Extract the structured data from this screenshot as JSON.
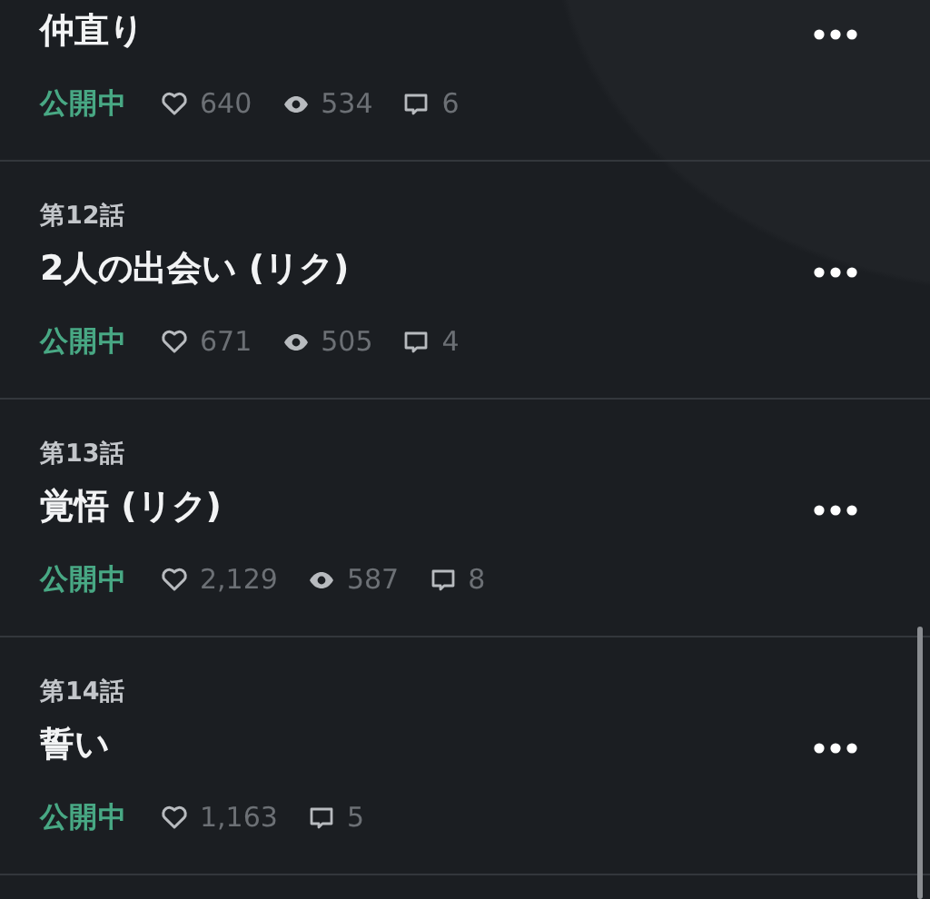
{
  "episodes": [
    {
      "title": "仲直り",
      "status": "公開中",
      "stats": [
        {
          "kind": "like",
          "value": "640"
        },
        {
          "kind": "view",
          "value": "534"
        },
        {
          "kind": "comment",
          "value": "6"
        }
      ]
    },
    {
      "episode": "第12話",
      "title": "2人の出会い (リク)",
      "status": "公開中",
      "stats": [
        {
          "kind": "like",
          "value": "671"
        },
        {
          "kind": "view",
          "value": "505"
        },
        {
          "kind": "comment",
          "value": "4"
        }
      ]
    },
    {
      "episode": "第13話",
      "title": "覚悟 (リク)",
      "status": "公開中",
      "stats": [
        {
          "kind": "like",
          "value": "2,129"
        },
        {
          "kind": "view",
          "value": "587"
        },
        {
          "kind": "comment",
          "value": "8"
        }
      ]
    },
    {
      "episode": "第14話",
      "title": "誓い",
      "status": "公開中",
      "stats": [
        {
          "kind": "like",
          "value": "1,163"
        },
        {
          "kind": "comment",
          "value": "5"
        }
      ]
    }
  ]
}
